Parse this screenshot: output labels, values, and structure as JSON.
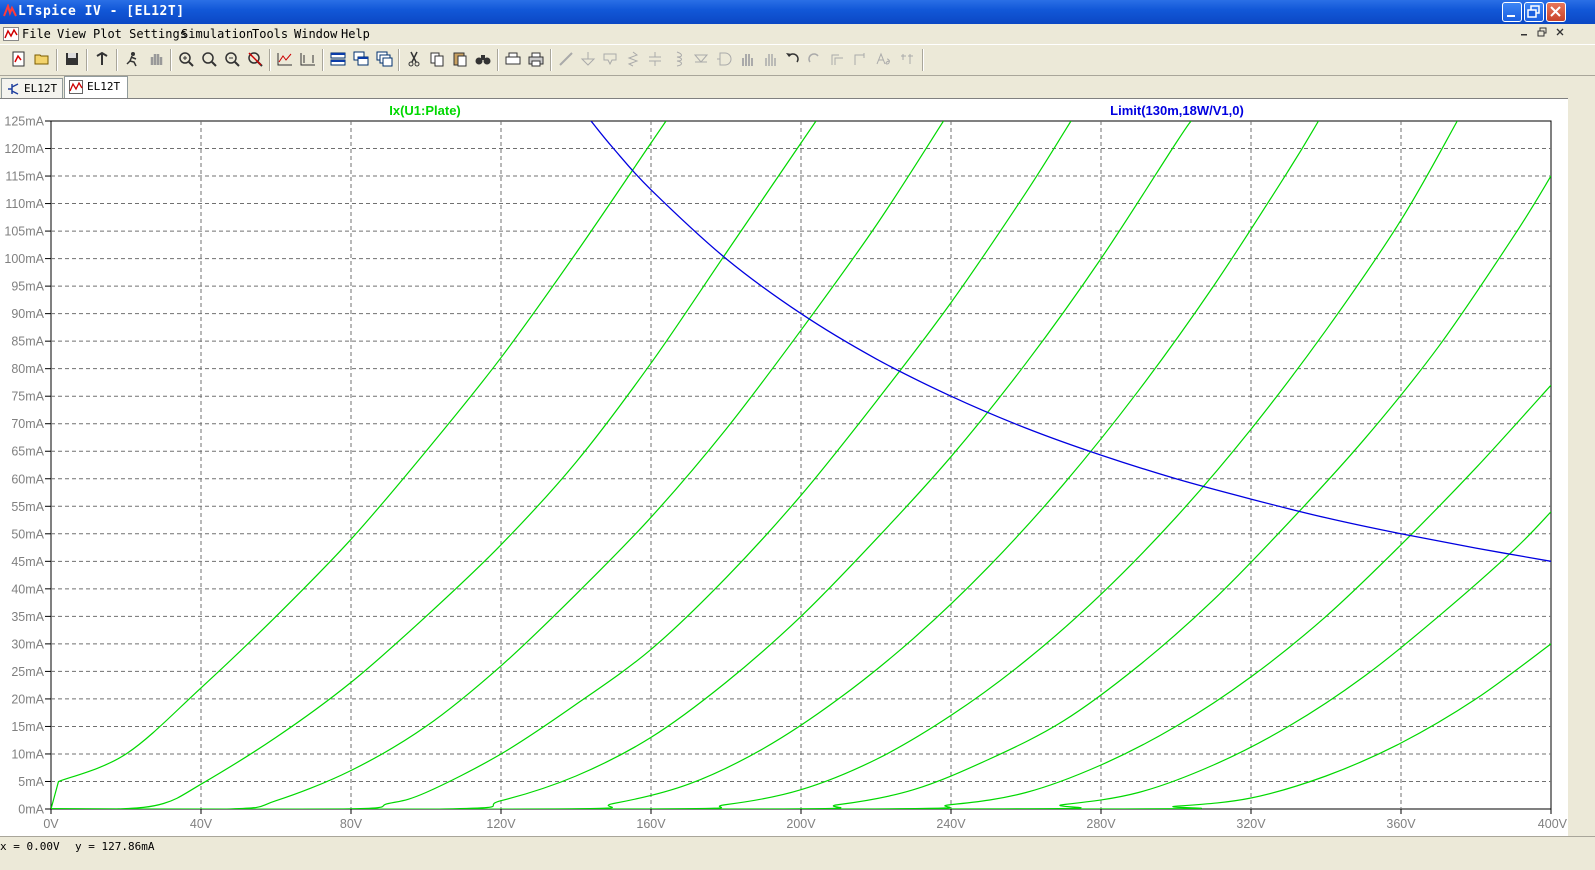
{
  "window": {
    "title": "LTspice IV - [EL12T]",
    "buttons": [
      "minimize",
      "restore",
      "close"
    ]
  },
  "menu": {
    "items": [
      {
        "label": "File",
        "hotkey": "F"
      },
      {
        "label": "View",
        "hotkey": "V"
      },
      {
        "label": "Plot Settings",
        "hotkey": "P"
      },
      {
        "label": "Simulation",
        "hotkey": "S"
      },
      {
        "label": "Tools",
        "hotkey": "T"
      },
      {
        "label": "Window",
        "hotkey": "W"
      },
      {
        "label": "Help",
        "hotkey": "H"
      }
    ]
  },
  "toolbar": {
    "icons": [
      "new-schematic-icon",
      "open-icon",
      "save-icon",
      "control-panel-icon",
      "run-icon",
      "halt-icon",
      "zoom-in-icon",
      "zoom-area-icon",
      "zoom-out-icon",
      "zoom-cancel-icon",
      "autorange-icon",
      "add-trace-icon",
      "tile-horizontal-icon",
      "cascade-icon",
      "tile-vertical-icon",
      "cut-icon",
      "copy-icon",
      "paste-icon",
      "find-icon",
      "print-setup-icon",
      "print-icon",
      "wire-icon",
      "ground-icon",
      "label-net-icon",
      "resistor-icon",
      "capacitor-icon",
      "inductor-icon",
      "diode-icon",
      "component-icon",
      "move-icon",
      "drag-icon",
      "undo-icon",
      "redo-icon",
      "rotate-icon",
      "mirror-icon",
      "text-icon",
      "spice-directive-icon"
    ]
  },
  "tabs": [
    {
      "label": "EL12T",
      "kind": "schematic"
    },
    {
      "label": "EL12T",
      "kind": "waveform"
    }
  ],
  "status": {
    "x_readout": "x = 0.00V",
    "y_readout": "y = 127.86mA"
  },
  "colors": {
    "trace_plate": "#00d800",
    "trace_limit": "#0000e0",
    "grid": "#707070",
    "axis_text": "#808080"
  },
  "chart_data": {
    "type": "line",
    "title": "",
    "xlabel": "",
    "ylabel": "",
    "xlim": [
      0,
      400
    ],
    "ylim": [
      0,
      125
    ],
    "x_unit": "V",
    "y_unit": "mA",
    "x_ticks": [
      "0V",
      "40V",
      "80V",
      "120V",
      "160V",
      "200V",
      "240V",
      "280V",
      "320V",
      "360V",
      "400V"
    ],
    "y_ticks": [
      "0mA",
      "5mA",
      "10mA",
      "15mA",
      "20mA",
      "25mA",
      "30mA",
      "35mA",
      "40mA",
      "45mA",
      "50mA",
      "55mA",
      "60mA",
      "65mA",
      "70mA",
      "75mA",
      "80mA",
      "85mA",
      "90mA",
      "95mA",
      "100mA",
      "105mA",
      "110mA",
      "115mA",
      "120mA",
      "125mA"
    ],
    "grid": true,
    "series": [
      {
        "name": "Ix(U1:Plate)",
        "color": "#00d800",
        "curves": [
          [
            [
              0,
              0
            ],
            [
              2,
              5
            ],
            [
              20,
              10
            ],
            [
              40,
              22
            ],
            [
              60,
              35
            ],
            [
              80,
              49
            ],
            [
              100,
              65
            ],
            [
              120,
              82
            ],
            [
              140,
              101
            ],
            [
              160,
              121
            ],
            [
              164,
              125
            ]
          ],
          [
            [
              0,
              0
            ],
            [
              18,
              0
            ],
            [
              30,
              1
            ],
            [
              40,
              4.5
            ],
            [
              60,
              13
            ],
            [
              80,
              23
            ],
            [
              100,
              35
            ],
            [
              120,
              48
            ],
            [
              140,
              63
            ],
            [
              160,
              81
            ],
            [
              180,
              101
            ],
            [
              200,
              121
            ],
            [
              204,
              125
            ]
          ],
          [
            [
              0,
              0
            ],
            [
              48,
              0
            ],
            [
              60,
              1.5
            ],
            [
              80,
              7
            ],
            [
              100,
              15
            ],
            [
              120,
              26
            ],
            [
              140,
              39
            ],
            [
              160,
              53
            ],
            [
              180,
              69
            ],
            [
              200,
              87
            ],
            [
              220,
              106
            ],
            [
              238,
              125
            ]
          ],
          [
            [
              0,
              0
            ],
            [
              78,
              0
            ],
            [
              90,
              1
            ],
            [
              100,
              3
            ],
            [
              120,
              10
            ],
            [
              140,
              19
            ],
            [
              160,
              29
            ],
            [
              180,
              42
            ],
            [
              200,
              57
            ],
            [
              220,
              74
            ],
            [
              240,
              92
            ],
            [
              260,
              112
            ],
            [
              272,
              125
            ]
          ],
          [
            [
              0,
              0
            ],
            [
              105,
              0
            ],
            [
              120,
              1.5
            ],
            [
              140,
              6
            ],
            [
              160,
              13
            ],
            [
              180,
              23
            ],
            [
              200,
              35
            ],
            [
              220,
              49
            ],
            [
              240,
              64
            ],
            [
              260,
              81
            ],
            [
              280,
              100
            ],
            [
              300,
              121
            ],
            [
              304,
              125
            ]
          ],
          [
            [
              0,
              0
            ],
            [
              135,
              0
            ],
            [
              150,
              1
            ],
            [
              170,
              4.5
            ],
            [
              190,
              11
            ],
            [
              210,
              20
            ],
            [
              230,
              31
            ],
            [
              250,
              44
            ],
            [
              270,
              59
            ],
            [
              290,
              76
            ],
            [
              310,
              95
            ],
            [
              330,
              116
            ],
            [
              338,
              125
            ]
          ],
          [
            [
              0,
              0
            ],
            [
              160,
              0
            ],
            [
              180,
              0.8
            ],
            [
              200,
              3.5
            ],
            [
              220,
              9
            ],
            [
              240,
              17
            ],
            [
              260,
              27
            ],
            [
              280,
              39
            ],
            [
              300,
              53
            ],
            [
              320,
              69
            ],
            [
              340,
              87
            ],
            [
              360,
              107
            ],
            [
              375,
              125
            ]
          ],
          [
            [
              0,
              0
            ],
            [
              190,
              0
            ],
            [
              210,
              0.8
            ],
            [
              230,
              3.5
            ],
            [
              250,
              9
            ],
            [
              270,
              16
            ],
            [
              290,
              26
            ],
            [
              310,
              38
            ],
            [
              330,
              52
            ],
            [
              350,
              67
            ],
            [
              370,
              84
            ],
            [
              390,
              104
            ],
            [
              400,
              115
            ]
          ],
          [
            [
              0,
              0
            ],
            [
              215,
              0
            ],
            [
              240,
              0.8
            ],
            [
              260,
              3
            ],
            [
              280,
              8
            ],
            [
              300,
              15
            ],
            [
              320,
              24
            ],
            [
              340,
              35
            ],
            [
              360,
              48
            ],
            [
              380,
              62
            ],
            [
              400,
              77
            ]
          ],
          [
            [
              0,
              0
            ],
            [
              250,
              0
            ],
            [
              270,
              0.8
            ],
            [
              290,
              3
            ],
            [
              310,
              8
            ],
            [
              330,
              15
            ],
            [
              350,
              24
            ],
            [
              370,
              35
            ],
            [
              390,
              47
            ],
            [
              400,
              54
            ]
          ],
          [
            [
              0,
              0
            ],
            [
              280,
              0
            ],
            [
              300,
              0.5
            ],
            [
              320,
              2
            ],
            [
              340,
              6
            ],
            [
              360,
              12
            ],
            [
              380,
              20
            ],
            [
              400,
              30
            ]
          ]
        ]
      },
      {
        "name": "Limit(130m,18W/V1,0)",
        "color": "#0000e0",
        "points": [
          [
            144,
            125
          ],
          [
            150,
            120
          ],
          [
            160,
            112.5
          ],
          [
            180,
            100
          ],
          [
            200,
            90
          ],
          [
            220,
            81.8
          ],
          [
            240,
            75
          ],
          [
            260,
            69.2
          ],
          [
            280,
            64.3
          ],
          [
            300,
            60
          ],
          [
            320,
            56.3
          ],
          [
            340,
            52.9
          ],
          [
            360,
            50
          ],
          [
            380,
            47.4
          ],
          [
            400,
            45
          ]
        ]
      }
    ]
  }
}
